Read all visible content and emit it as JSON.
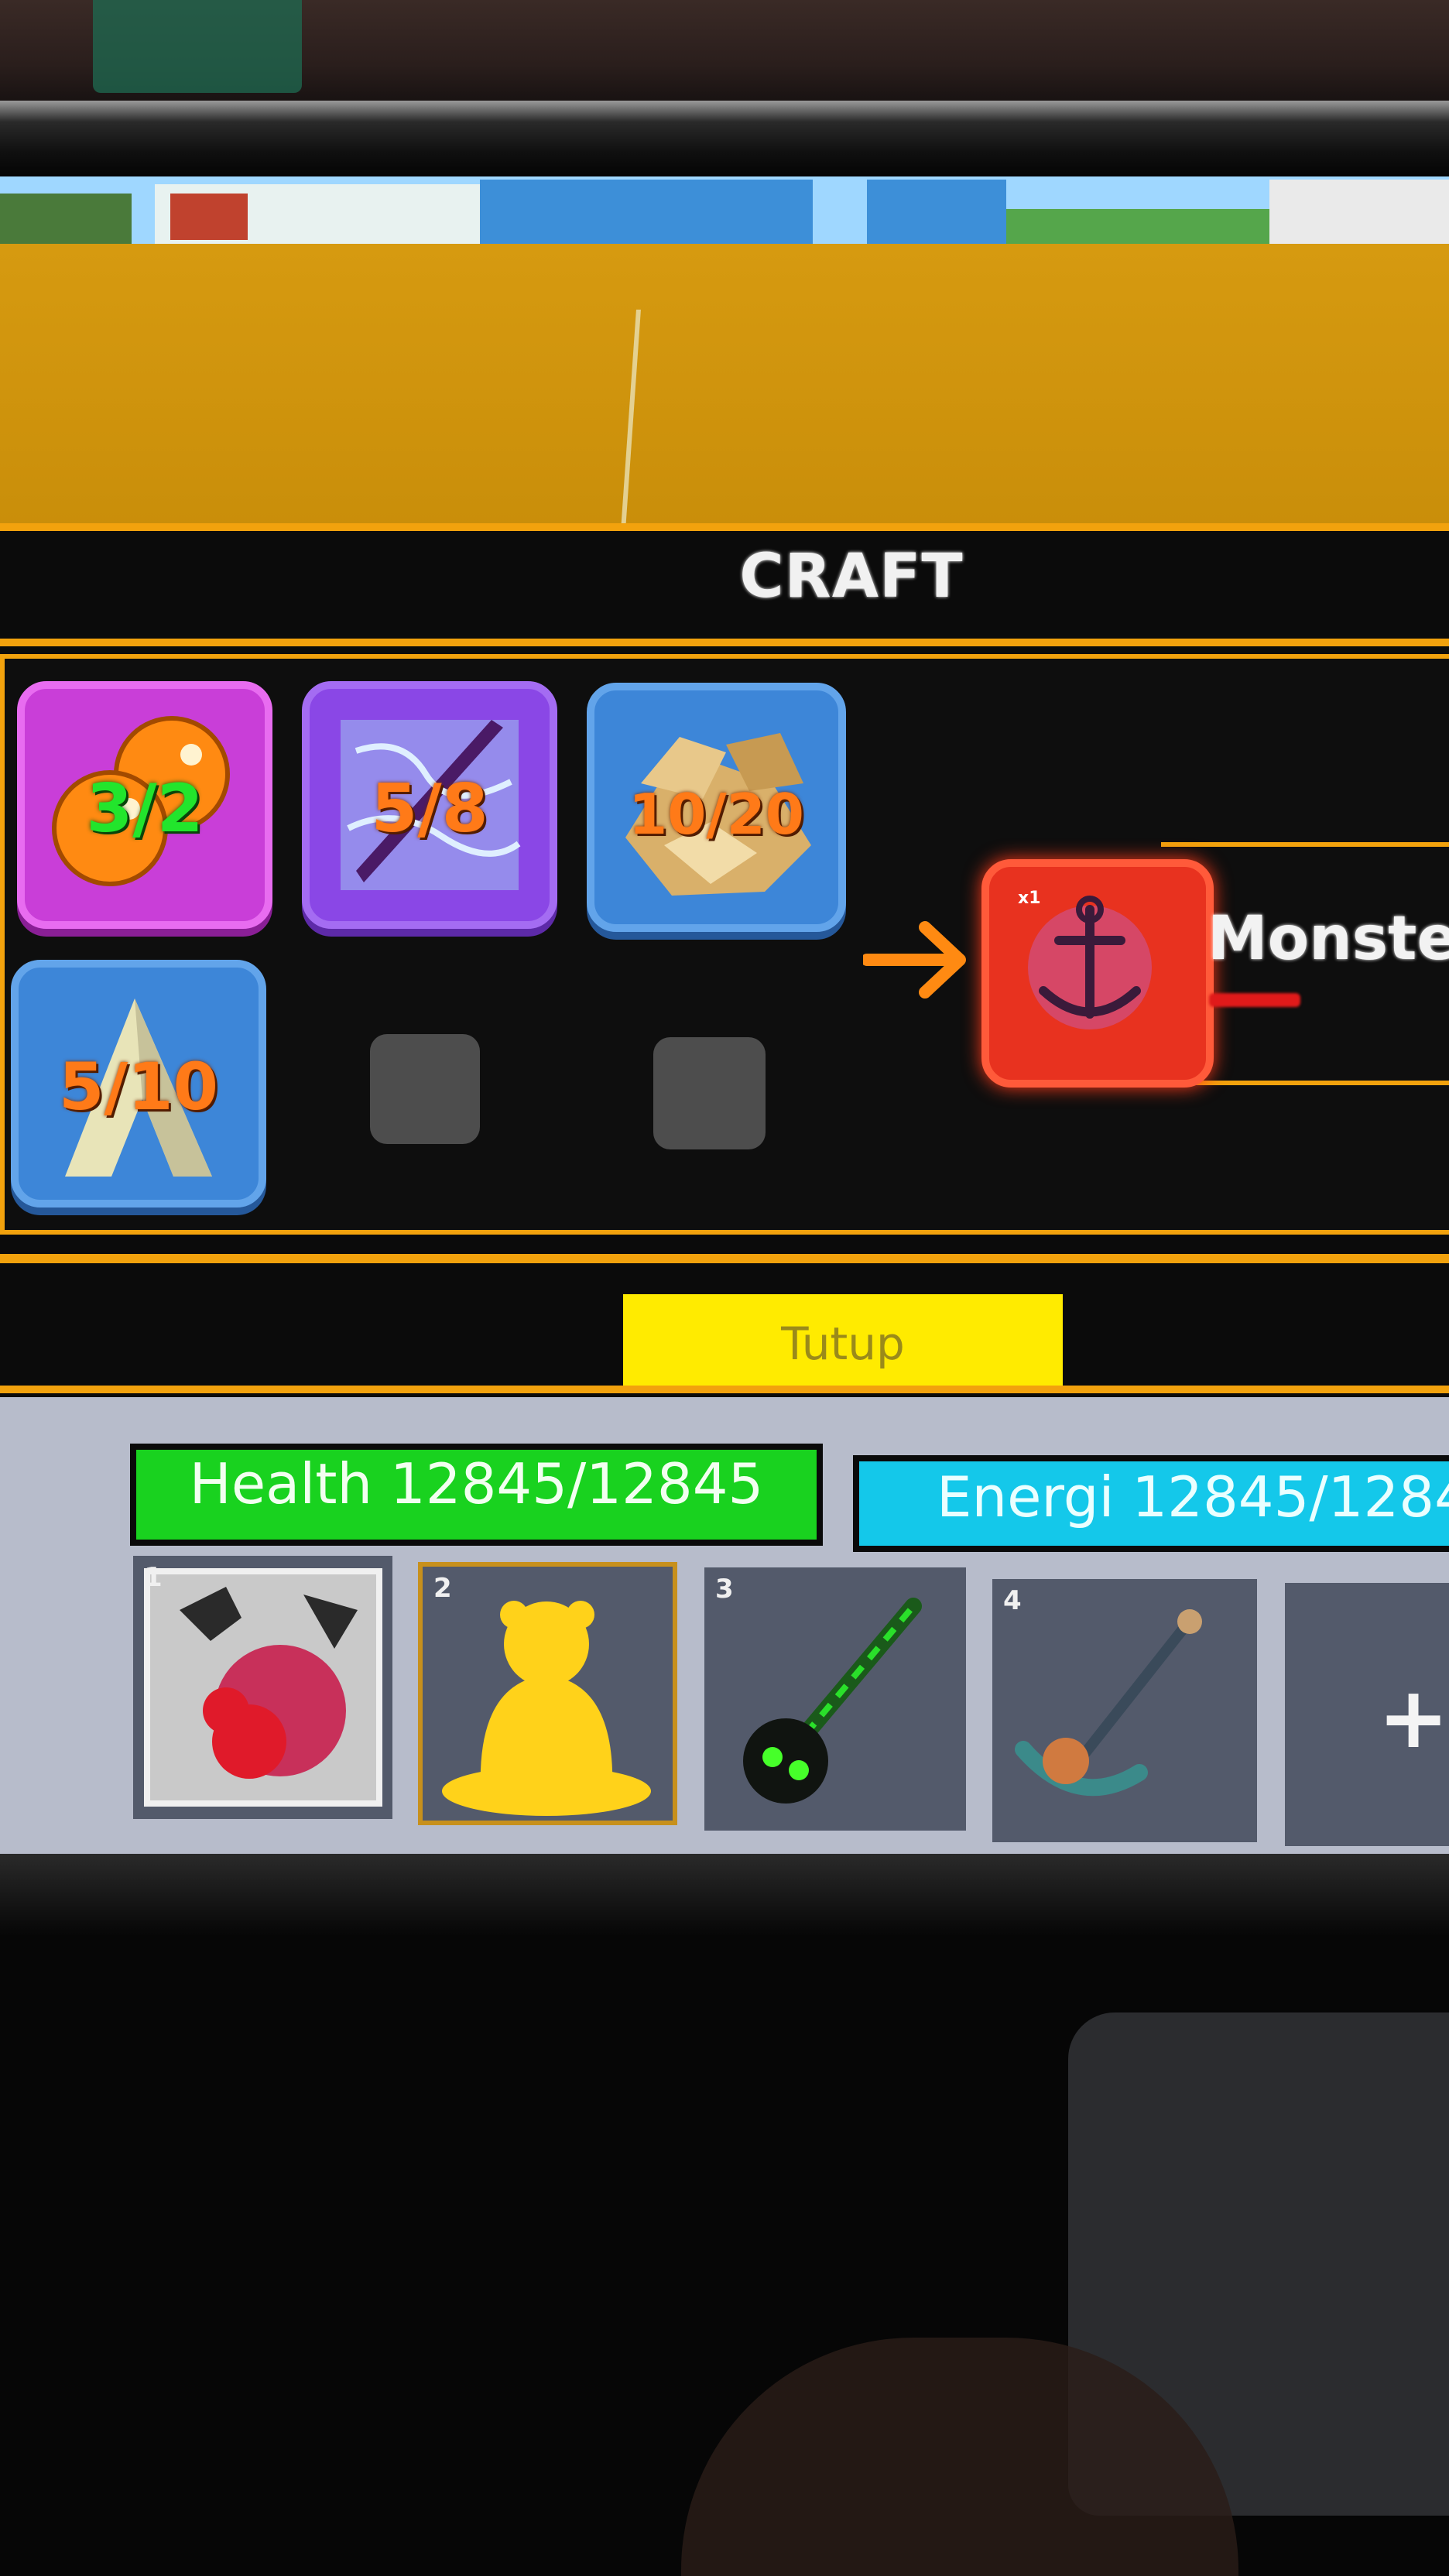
{
  "craft": {
    "title": "CRAFT",
    "ingredients": [
      {
        "name": "orange-orbs",
        "count": "3/2",
        "count_color": "#22e52c"
      },
      {
        "name": "lightning-shard",
        "count": "5/8",
        "count_color": "#ff7a18"
      },
      {
        "name": "gold-ore",
        "count": "10/20",
        "count_color": "#ff7a18"
      },
      {
        "name": "bone-fang",
        "count": "5/10",
        "count_color": "#ff7a18"
      }
    ],
    "result": {
      "name": "Monster",
      "quantity": "x1",
      "rarity_color": "#e01a1a"
    },
    "close_label": "Tutup"
  },
  "hud": {
    "health_text": "Health 12845/12845",
    "energy_text": "Energi 12845/1284",
    "hotbar": [
      {
        "slot": "1",
        "item": "fruit-icon"
      },
      {
        "slot": "2",
        "item": "buddha-icon"
      },
      {
        "slot": "3",
        "item": "skull-staff-icon"
      },
      {
        "slot": "4",
        "item": "anchor-icon"
      },
      {
        "slot": "",
        "item": "add-icon",
        "label": "+"
      }
    ]
  },
  "colors": {
    "accent_gold": "#f2a20d",
    "button_yellow": "#ffeb00",
    "health_green": "#19d21f",
    "energy_cyan": "#14c8ea"
  }
}
